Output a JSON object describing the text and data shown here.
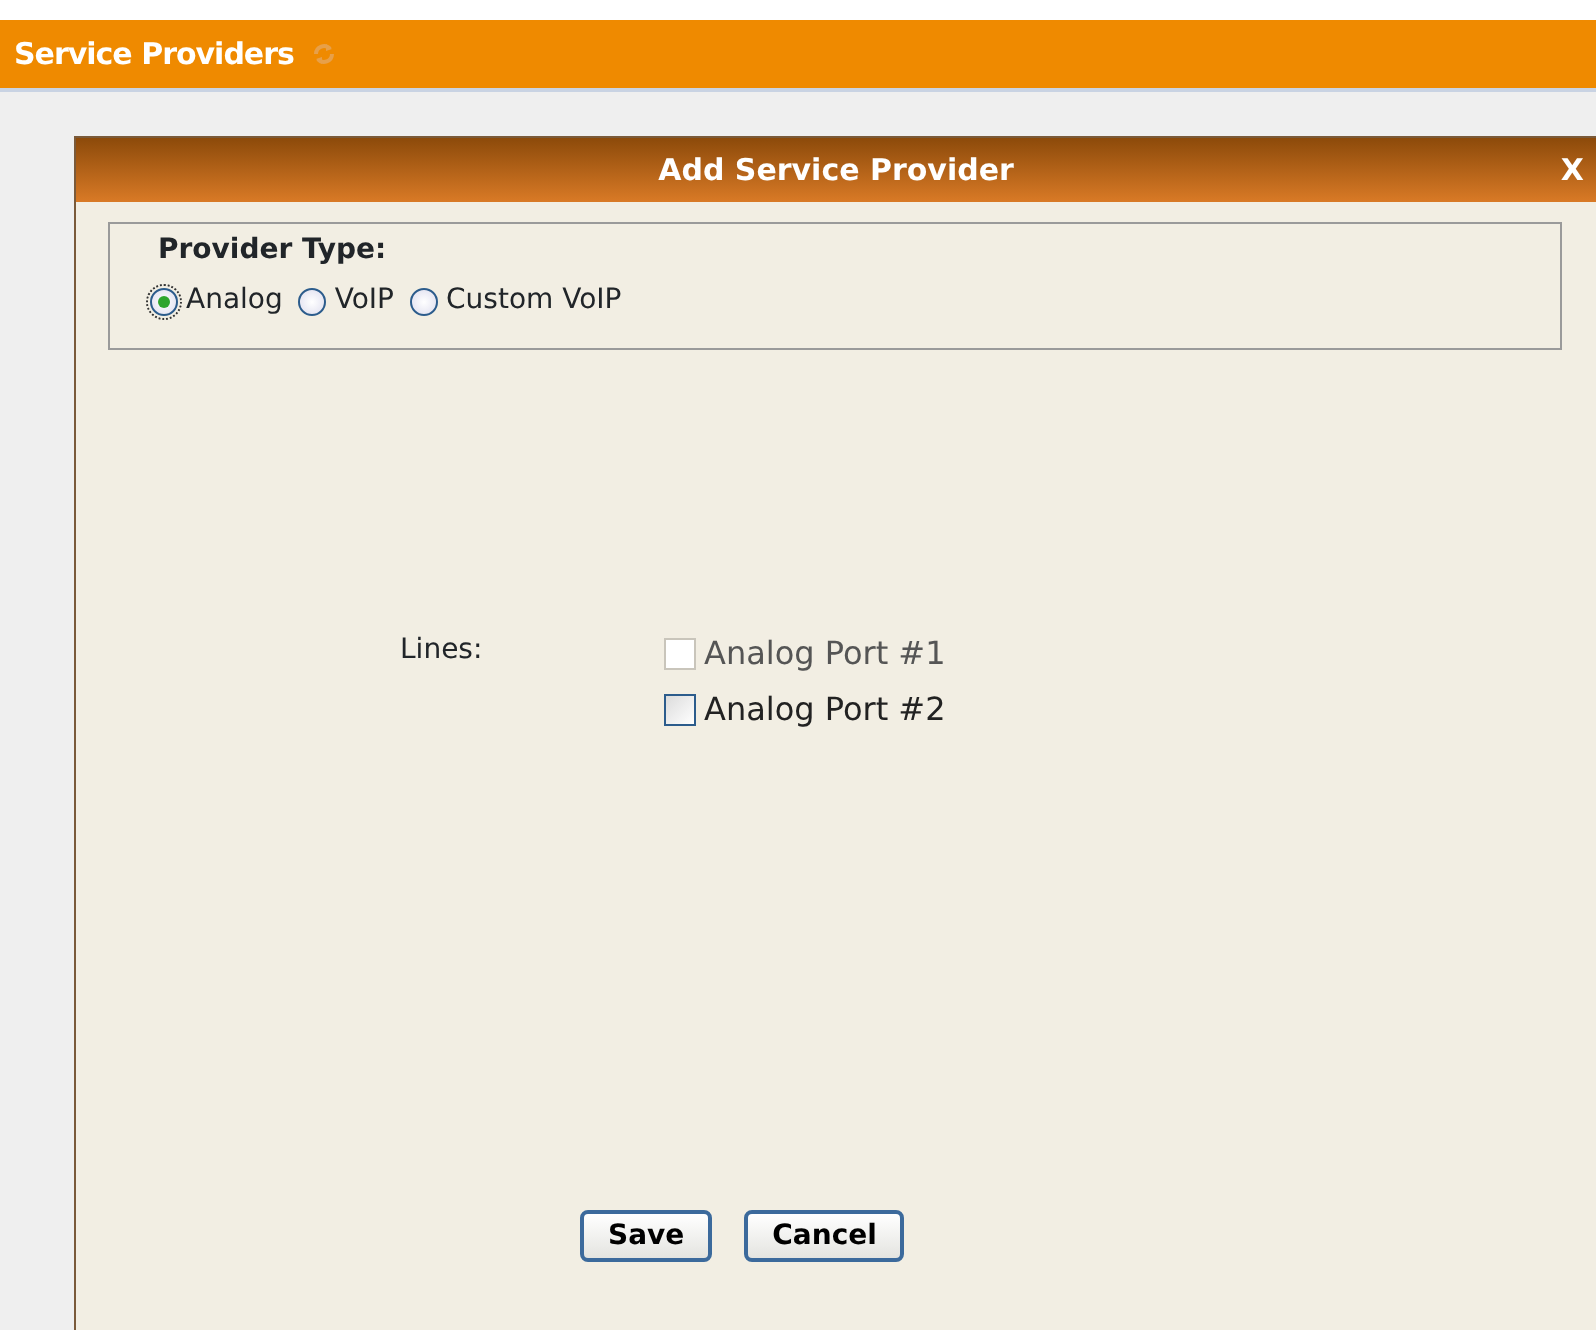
{
  "header": {
    "title": "Service Providers"
  },
  "dialog": {
    "title": "Add Service Provider",
    "close": "X",
    "provider_type": {
      "legend": "Provider Type:",
      "options": [
        {
          "label": "Analog",
          "selected": true
        },
        {
          "label": "VoIP",
          "selected": false
        },
        {
          "label": "Custom VoIP",
          "selected": false
        }
      ]
    },
    "lines": {
      "label": "Lines:",
      "ports": [
        {
          "label": "Analog Port #1",
          "checked": false,
          "disabled": true
        },
        {
          "label": "Analog Port #2",
          "checked": false,
          "disabled": false
        }
      ]
    },
    "buttons": [
      "Save",
      "Cancel"
    ]
  }
}
